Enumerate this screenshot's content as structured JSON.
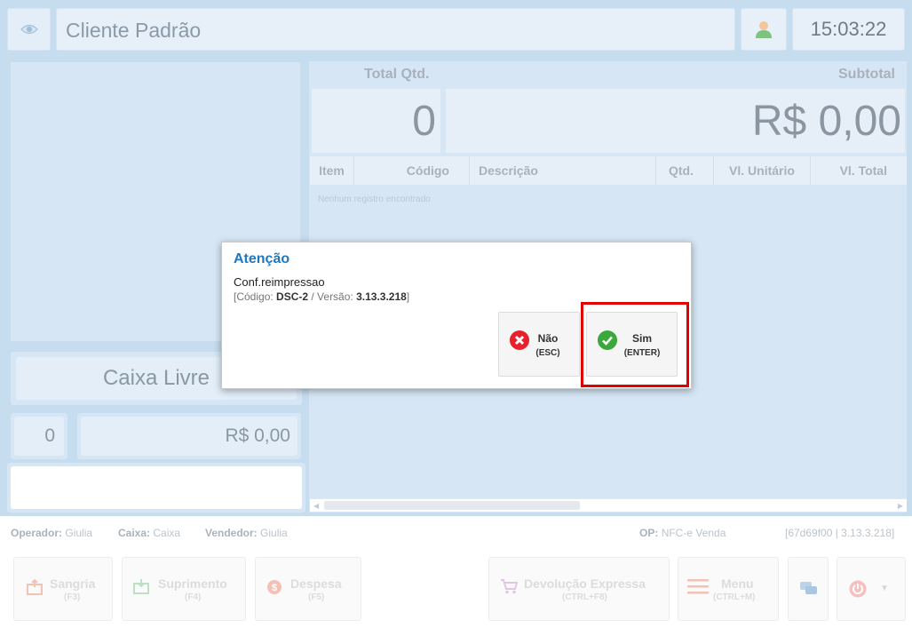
{
  "header": {
    "client_name": "Cliente Padrão",
    "clock": "15:03:22"
  },
  "left": {
    "status": "Caixa Livre",
    "item_count": "0",
    "item_value": "R$ 0,00"
  },
  "totals": {
    "total_qtd_label": "Total Qtd.",
    "total_qtd": "0",
    "subtotal_label": "Subtotal",
    "subtotal": "R$ 0,00"
  },
  "table": {
    "columns": [
      "Item",
      "Código",
      "Descrição",
      "Qtd.",
      "Vl. Unitário",
      "Vl. Total"
    ],
    "empty_message": "Nenhum registro encontrado"
  },
  "status_bar": {
    "operador_label": "Operador:",
    "operador": "Giulia",
    "caixa_label": "Caixa:",
    "caixa": "Caixa",
    "vendedor_label": "Vendedor:",
    "vendedor": "Giulia",
    "op_label": "OP:",
    "op": "NFC-e Venda",
    "build": "[67d69f00 | 3.13.3.218]"
  },
  "actions": {
    "sangria": {
      "label": "Sangria",
      "key": "(F3)"
    },
    "suprimento": {
      "label": "Suprimento",
      "key": "(F4)"
    },
    "despesa": {
      "label": "Despesa",
      "key": "(F5)"
    },
    "devolucao": {
      "label": "Devolução Expressa",
      "key": "(CTRL+F8)"
    },
    "menu": {
      "label": "Menu",
      "key": "(CTRL+M)"
    }
  },
  "dialog": {
    "title": "Atenção",
    "message": "Conf.reimpressao",
    "code_prefix": "[Código: ",
    "code": "DSC-2",
    "version_prefix": " / Versão: ",
    "version": "3.13.3.218",
    "code_suffix": "]",
    "no_label": "Não",
    "no_key": "(ESC)",
    "yes_label": "Sim",
    "yes_key": "(ENTER)"
  },
  "colors": {
    "panel_bg": "#c6dcef",
    "dialog_title": "#1e78c0",
    "highlight": "#e00000",
    "no_icon": "#e8202c",
    "yes_icon": "#3aa83a"
  }
}
